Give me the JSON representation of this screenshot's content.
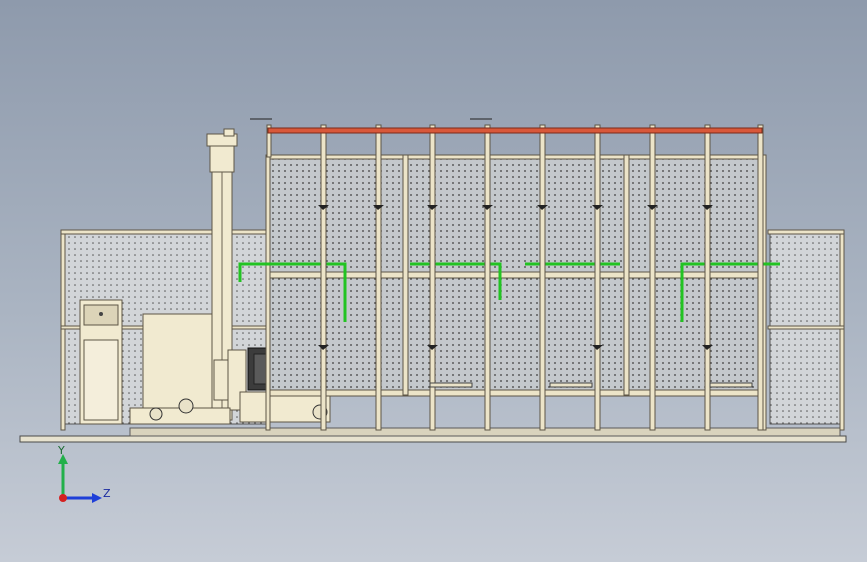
{
  "view": {
    "background_top": "#8e9aac",
    "background_bottom": "#c6ccd6",
    "frame_color": "#ece4c8",
    "rail_color": "#d8583a",
    "pipe_color": "#22c322"
  },
  "triad": {
    "y_label": "Y",
    "z_label": "Z",
    "y_color": "#22b04a",
    "z_color": "#1e3fd8",
    "origin_color": "#d42020"
  }
}
